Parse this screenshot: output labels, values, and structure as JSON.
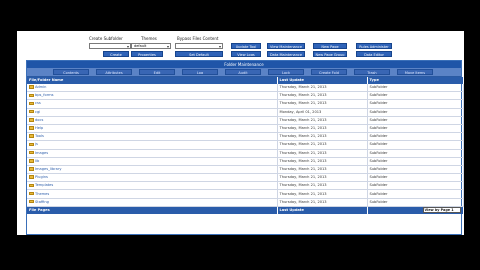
{
  "toolbar": {
    "create_subfolder_label": "Create Subfolder",
    "themes_label": "Themes",
    "bypass_files_label": "Bypass Files Content",
    "subfolder_value": "",
    "theme_value": "default",
    "bypass_value": "",
    "create_button": "Create",
    "properties_button": "Properties",
    "set_default_button": "Set Default",
    "update_tool_button": "Update Tool",
    "view_maintenance_button": "View Maintenance",
    "view_logs_button": "View Logs",
    "data_maintenance_button": "Data Maintenance",
    "new_page_button": "New Page",
    "new_page_group_button": "New Page Group",
    "rules_administer_button": "Rules Administer",
    "data_editor_button": "Data Editor"
  },
  "panel": {
    "title": "Folder Maintenance",
    "tabs": [
      "Contents",
      "Attributes",
      "Edit",
      "Log",
      "Audit",
      "Lock",
      "Create Fold",
      "Trash",
      "Move Items"
    ]
  },
  "table": {
    "columns": [
      "File/Folder Name",
      "Last Update",
      "Type"
    ],
    "rows": [
      {
        "name": "Admin",
        "date": "Thursday, March 21, 2013",
        "type": "SubFolder"
      },
      {
        "name": "bps_forms",
        "date": "Thursday, March 21, 2013",
        "type": "SubFolder"
      },
      {
        "name": "css",
        "date": "Thursday, March 21, 2013",
        "type": "SubFolder"
      },
      {
        "name": "cgi",
        "date": "Monday, April 01, 2013",
        "type": "SubFolder"
      },
      {
        "name": "docs",
        "date": "Thursday, March 21, 2013",
        "type": "SubFolder"
      },
      {
        "name": "Help",
        "date": "Thursday, March 21, 2013",
        "type": "SubFolder"
      },
      {
        "name": "Tools",
        "date": "Thursday, March 21, 2013",
        "type": "SubFolder"
      },
      {
        "name": "js",
        "date": "Thursday, March 21, 2013",
        "type": "SubFolder"
      },
      {
        "name": "Images",
        "date": "Thursday, March 21, 2013",
        "type": "SubFolder"
      },
      {
        "name": "lib",
        "date": "Thursday, March 21, 2013",
        "type": "SubFolder"
      },
      {
        "name": "Images_library",
        "date": "Thursday, March 21, 2013",
        "type": "SubFolder"
      },
      {
        "name": "Plugins",
        "date": "Thursday, March 21, 2013",
        "type": "SubFolder"
      },
      {
        "name": "Templates",
        "date": "Thursday, March 21, 2013",
        "type": "SubFolder"
      },
      {
        "name": "Themes",
        "date": "Thursday, March 21, 2013",
        "type": "SubFolder"
      },
      {
        "name": "Staffing",
        "date": "Thursday, March 21, 2013",
        "type": "SubFolder"
      }
    ],
    "footer_columns": [
      "File Pages",
      "Last Update",
      ""
    ],
    "view_select_value": "View by Page 1"
  }
}
